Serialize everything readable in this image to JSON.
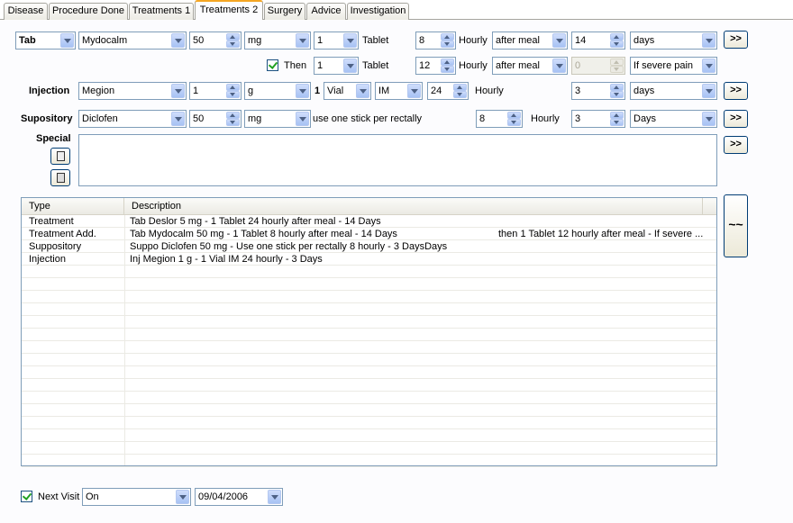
{
  "tabs": [
    {
      "label": "Disease"
    },
    {
      "label": "Procedure Done"
    },
    {
      "label": "Treatments 1"
    },
    {
      "label": "Treatments 2"
    },
    {
      "label": "Surgery"
    },
    {
      "label": "Advice"
    },
    {
      "label": "Investigation"
    }
  ],
  "active_tab": "Treatments 2",
  "tab_row": {
    "form": "Tab",
    "drug": "Mydocalm",
    "dose": "50",
    "unit": "mg",
    "qty": "1",
    "qty_label": "Tablet",
    "interval": "8",
    "interval_label": "Hourly",
    "timing": "after meal",
    "duration": "14",
    "duration_unit": "days",
    "add_button": ">>"
  },
  "then_row": {
    "then_label": "Then",
    "then_checked": true,
    "qty": "1",
    "qty_label": "Tablet",
    "interval": "12",
    "interval_label": "Hourly",
    "timing": "after meal",
    "duration": "0",
    "condition": "If severe pain"
  },
  "injection_row": {
    "label": "Injection",
    "drug": "Megion",
    "dose": "1",
    "unit": "g",
    "count": "1",
    "vial": "Vial",
    "route": "IM",
    "interval": "24",
    "interval_label": "Hourly",
    "duration": "3",
    "duration_unit": "days",
    "add_button": ">>"
  },
  "suppository_row": {
    "label": "Supository",
    "drug": "Diclofen",
    "dose": "50",
    "unit": "mg",
    "usage": "use one stick per rectally",
    "interval": "8",
    "interval_label": "Hourly",
    "duration": "3",
    "duration_unit": "Days",
    "add_button": ">>"
  },
  "special": {
    "label": "Special",
    "text": "",
    "add_button": ">>"
  },
  "grid": {
    "columns": [
      "Type",
      "Description"
    ],
    "rows": [
      {
        "type": "Treatment",
        "description": "Tab Deslor 5 mg - 1 Tablet 24 hourly after meal - 14 Days",
        "extra": ""
      },
      {
        "type": "Treatment Add.",
        "description": "Tab Mydocalm 50 mg - 1 Tablet 8 hourly after meal - 14 Days",
        "extra": "then 1 Tablet 12 hourly after meal - If severe ..."
      },
      {
        "type": "Suppository",
        "description": "Suppo Diclofen  50 mg - Use one stick per rectally 8 hourly - 3 DaysDays",
        "extra": ""
      },
      {
        "type": "Injection",
        "description": "Inj Megion  1 g - 1 Vial IM 24 hourly - 3 Days",
        "extra": ""
      }
    ]
  },
  "side_button": "~~",
  "next_visit": {
    "label": "Next Visit",
    "checked": true,
    "mode": "On",
    "date": "09/04/2006"
  }
}
